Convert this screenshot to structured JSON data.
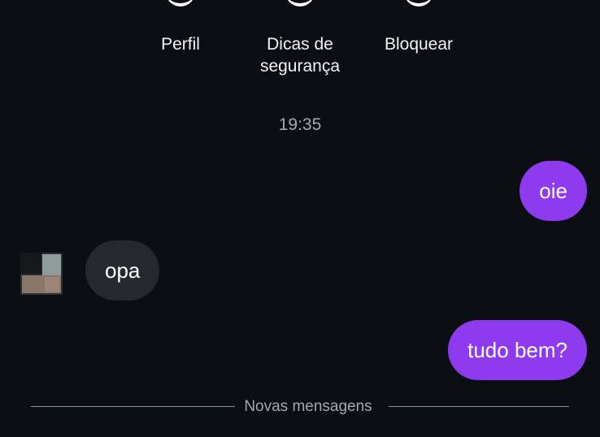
{
  "actions": [
    {
      "label": "Perfil",
      "icon": "profile-icon"
    },
    {
      "label": "Dicas de\nsegurança",
      "icon": "security-tips-icon"
    },
    {
      "label": "Bloquear",
      "icon": "block-icon"
    }
  ],
  "timestamp": "19:35",
  "messages": [
    {
      "text": "oie",
      "direction": "outgoing"
    },
    {
      "text": "opa",
      "direction": "incoming"
    },
    {
      "text": "tudo bem?",
      "direction": "outgoing"
    }
  ],
  "divider": {
    "label": "Novas mensagens"
  },
  "colors": {
    "background": "#0b0f14",
    "outgoing_bubble": "#8e3bf0",
    "incoming_bubble": "#25282c",
    "muted_text": "#a3a8ad"
  }
}
